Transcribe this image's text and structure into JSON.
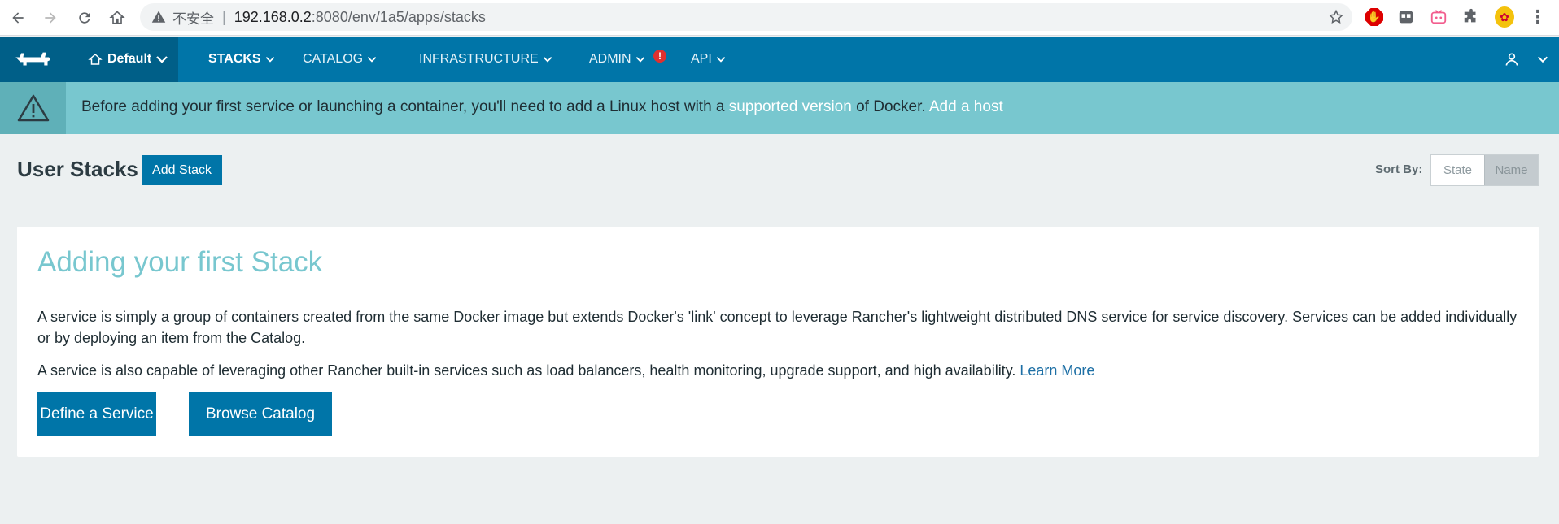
{
  "browser": {
    "insecure_label": "不安全",
    "separator": "|",
    "url_host": "192.168.0.2",
    "url_rest": ":8080/env/1a5/apps/stacks",
    "menu_glyph": "⋮"
  },
  "nav": {
    "environment": "Default",
    "items": [
      {
        "label": "STACKS",
        "active": true
      },
      {
        "label": "CATALOG",
        "active": false
      },
      {
        "label": "INFRASTRUCTURE",
        "active": false
      },
      {
        "label": "ADMIN",
        "active": false,
        "badge": "!"
      },
      {
        "label": "API",
        "active": false
      }
    ]
  },
  "alert": {
    "text_before": "Before adding your first service or launching a container, you'll need to add a Linux host with a ",
    "link_supported": "supported version",
    "text_middle": " of Docker. ",
    "link_add_host": "Add a host"
  },
  "header": {
    "title": "User Stacks",
    "add_stack_label": "Add Stack",
    "sort_by_label": "Sort By:",
    "sort_options": [
      "State",
      "Name"
    ],
    "sort_selected": "Name"
  },
  "card": {
    "title": "Adding your first Stack",
    "paragraph1": "A service is simply a group of containers created from the same Docker image but extends Docker's 'link' concept to leverage Rancher's lightweight distributed DNS service for service discovery. Services can be added individually or by deploying an item from the Catalog.",
    "paragraph2": "A service is also capable of leveraging other Rancher built-in services such as load balancers, health monitoring, upgrade support, and high availability. ",
    "learn_more": "Learn More",
    "define_service_label": "Define a Service",
    "browse_catalog_label": "Browse Catalog"
  },
  "colors": {
    "nav_bg": "#0075a8",
    "nav_dark": "#005f88",
    "alert_bg": "#78c7cf",
    "title_accent": "#78c7cf",
    "page_bg": "#ecf0f1"
  }
}
